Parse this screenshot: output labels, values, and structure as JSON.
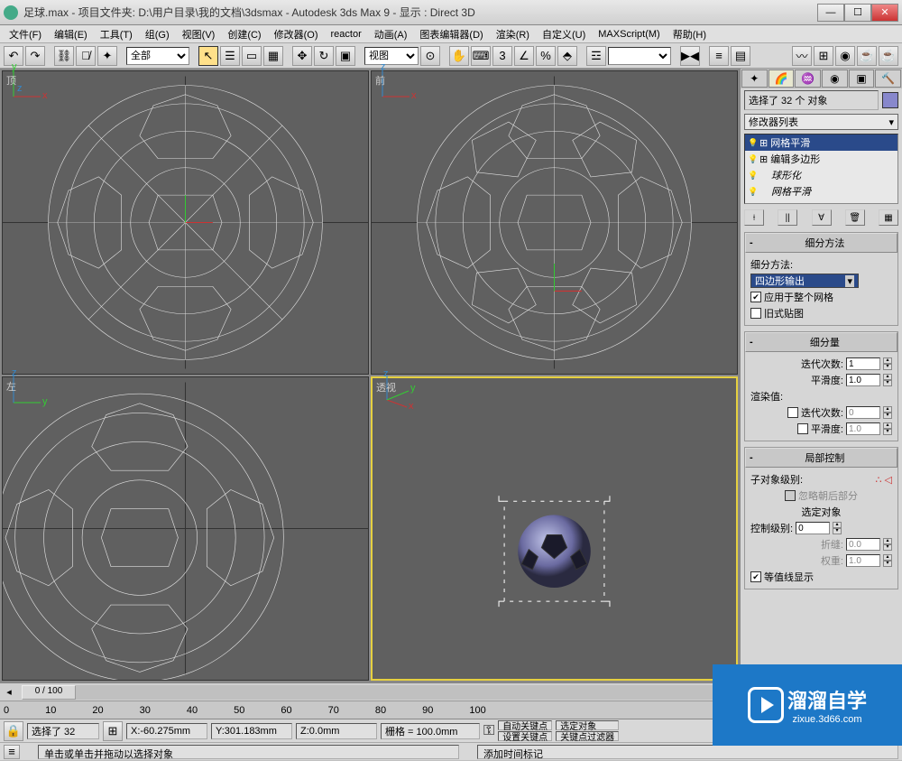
{
  "titlebar": {
    "text": "足球.max    - 项目文件夹: D:\\用户目录\\我的文档\\3dsmax      - Autodesk 3ds Max 9      - 显示 : Direct 3D"
  },
  "menu": {
    "items": [
      "文件(F)",
      "编辑(E)",
      "工具(T)",
      "组(G)",
      "视图(V)",
      "创建(C)",
      "修改器(O)",
      "reactor",
      "动画(A)",
      "图表编辑器(D)",
      "渲染(R)",
      "自定义(U)",
      "MAXScript(M)",
      "帮助(H)"
    ]
  },
  "toolbar": {
    "filter_label": "全部",
    "view_label": "视图"
  },
  "viewports": {
    "top": "顶",
    "front": "前",
    "left": "左",
    "persp": "透视"
  },
  "panel": {
    "selection": "选择了 32 个 对象",
    "modlist_label": "修改器列表",
    "modifiers": [
      {
        "name": "网格平滑",
        "on": true,
        "selected": true,
        "box": true
      },
      {
        "name": "编辑多边形",
        "on": true,
        "box": true
      },
      {
        "name": "球形化",
        "on": true,
        "italic": true
      },
      {
        "name": "网格平滑",
        "on": true,
        "italic": true
      }
    ],
    "rollout1": {
      "title": "细分方法",
      "method_label": "细分方法:",
      "method_value": "四边形输出",
      "apply_mesh": "应用于整个网格",
      "old_map": "旧式贴图"
    },
    "rollout2": {
      "title": "细分量",
      "iter_label": "迭代次数:",
      "iter_val": "1",
      "smooth_label": "平滑度:",
      "smooth_val": "1.0",
      "render_label": "渲染值:",
      "r_iter_val": "0",
      "r_smooth_val": "1.0"
    },
    "rollout3": {
      "title": "局部控制",
      "subobj_label": "子对象级别:",
      "ignore_back": "忽略朝后部分",
      "selected_obj": "选定对象",
      "ctrl_level_label": "控制级别:",
      "ctrl_level_val": "0",
      "crease_label": "折缝:",
      "crease_val": "0.0",
      "weight_label": "权重:",
      "weight_val": "1.0",
      "iso_display": "等值线显示"
    }
  },
  "timeline": {
    "current": "0 / 100",
    "ticks": [
      "0",
      "10",
      "20",
      "30",
      "40",
      "50",
      "60",
      "70",
      "80",
      "90",
      "100"
    ]
  },
  "status": {
    "sel_text": "选择了 32",
    "x": "X:-60.275mm",
    "y": "Y:301.183mm",
    "z": "Z:0.0mm",
    "grid": "栅格 = 100.0mm",
    "autokey": "自动关键点",
    "selobj": "选定对象",
    "setkey": "设置关键点",
    "keyfilter": "关键点过滤器"
  },
  "prompt": {
    "line1": "单击或单击并拖动以选择对象",
    "line2": "添加时间标记"
  },
  "watermark": {
    "main": "溜溜自学",
    "sub": "zixue.3d66.com"
  }
}
